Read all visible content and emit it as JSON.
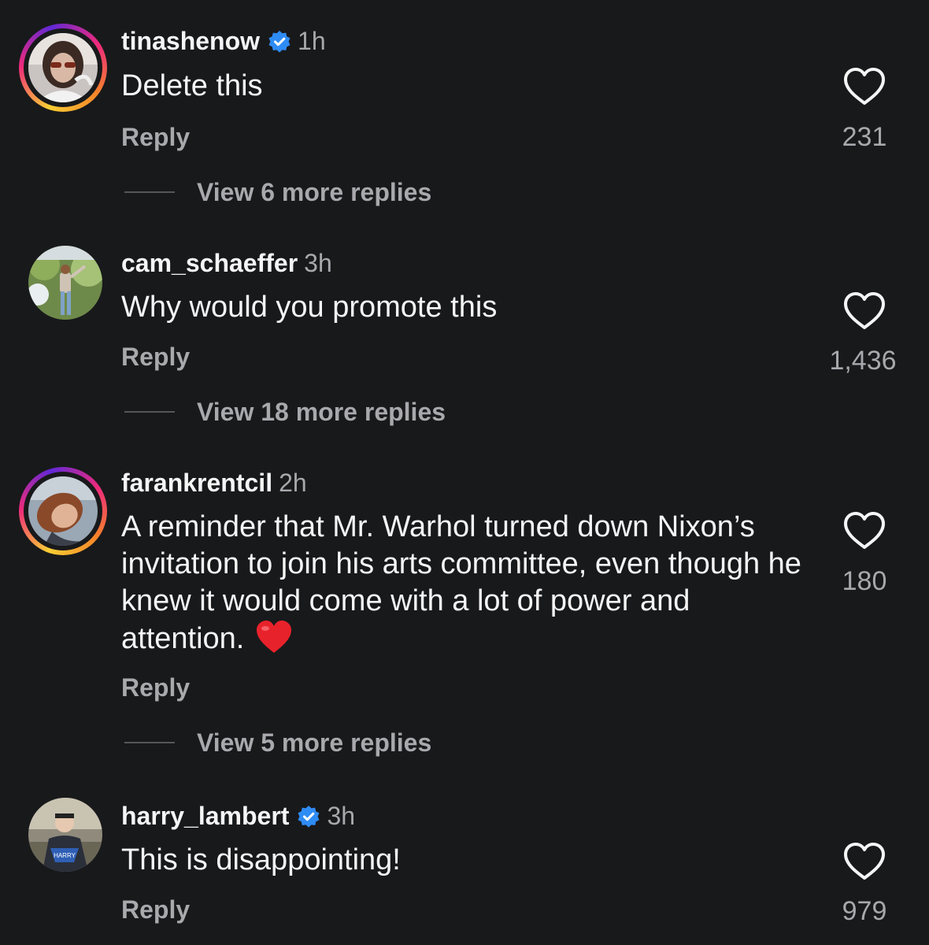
{
  "comments": [
    {
      "username": "tinashenow",
      "verified": true,
      "time": "1h",
      "text": "Delete this",
      "reply_label": "Reply",
      "view_replies": "View 6 more replies",
      "likes": "231",
      "avatar_ring": true
    },
    {
      "username": "cam_schaeffer",
      "verified": false,
      "time": "3h",
      "text": "Why would you promote this",
      "reply_label": "Reply",
      "view_replies": "View 18 more replies",
      "likes": "1,436",
      "avatar_ring": false
    },
    {
      "username": "farankrentcil",
      "verified": false,
      "time": "2h",
      "text": "A reminder that Mr. Warhol turned down Nixon’s invitation to join his arts committee, even though he knew it would come with a lot of power and attention.",
      "reply_label": "Reply",
      "view_replies": "View 5 more replies",
      "likes": "180",
      "avatar_ring": true
    },
    {
      "username": "harry_lambert",
      "verified": true,
      "time": "3h",
      "text": "This is disappointing!",
      "reply_label": "Reply",
      "likes": "979",
      "avatar_ring": false
    }
  ],
  "icons": {
    "like": "heart-outline-icon",
    "verified": "verified-badge-icon",
    "emoji": "red-heart-emoji-icon"
  },
  "colors": {
    "background": "#18191b",
    "text_primary": "#f5f5f5",
    "text_secondary": "#a8a8ad",
    "verified_blue": "#2f8cf5",
    "heart_red": "#e8222b"
  }
}
